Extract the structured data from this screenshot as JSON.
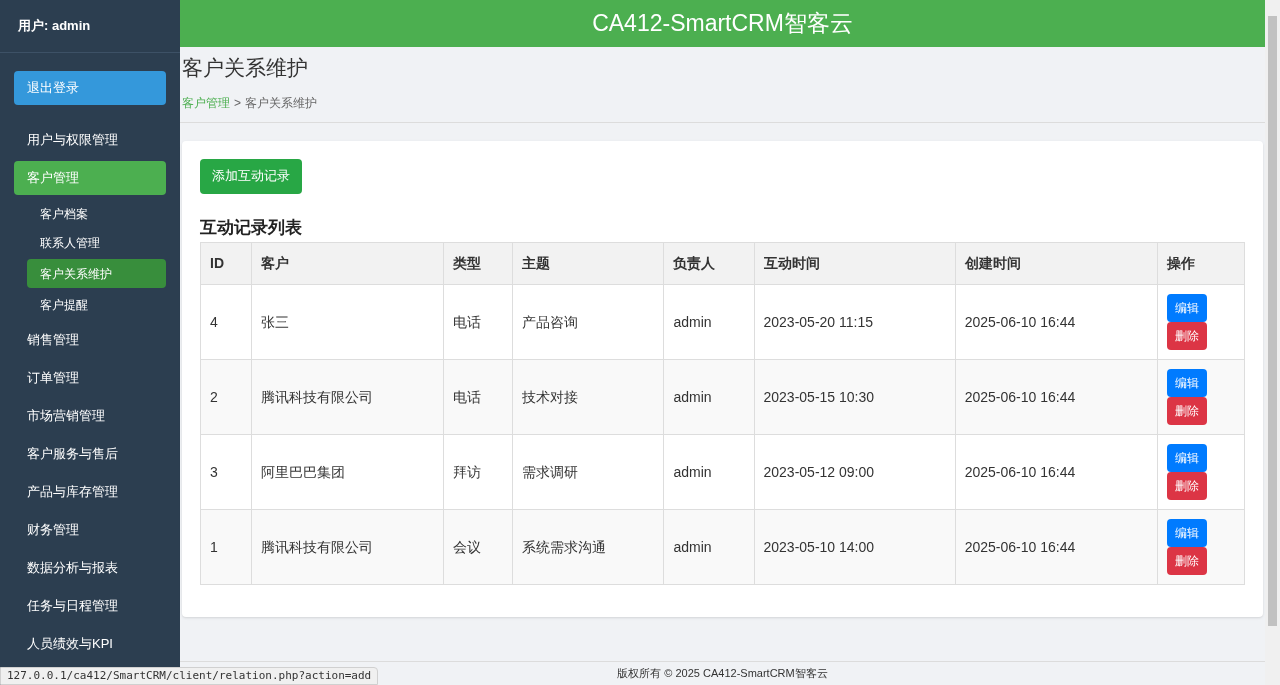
{
  "sidebar": {
    "user": "用户: admin",
    "logout": "退出登录",
    "items": [
      {
        "label": "用户与权限管理",
        "selected": false
      },
      {
        "label": "客户管理",
        "selected": true,
        "children": [
          {
            "label": "客户档案",
            "selected": false
          },
          {
            "label": "联系人管理",
            "selected": false
          },
          {
            "label": "客户关系维护",
            "selected": true
          },
          {
            "label": "客户提醒",
            "selected": false
          }
        ]
      },
      {
        "label": "销售管理",
        "selected": false
      },
      {
        "label": "订单管理",
        "selected": false
      },
      {
        "label": "市场营销管理",
        "selected": false
      },
      {
        "label": "客户服务与售后",
        "selected": false
      },
      {
        "label": "产品与库存管理",
        "selected": false
      },
      {
        "label": "财务管理",
        "selected": false
      },
      {
        "label": "数据分析与报表",
        "selected": false
      },
      {
        "label": "任务与日程管理",
        "selected": false
      },
      {
        "label": "人员绩效与KPI",
        "selected": false
      }
    ]
  },
  "header": {
    "title": "CA412-SmartCRM智客云"
  },
  "page": {
    "title": "客户关系维护",
    "breadcrumb": [
      {
        "label": "客户管理",
        "kind": "link"
      },
      {
        "label": ">",
        "kind": "separator"
      },
      {
        "label": "客户关系维护",
        "kind": "current"
      }
    ]
  },
  "add_button": "添加互动记录",
  "table": {
    "title": "互动记录列表",
    "columns": [
      "ID",
      "客户",
      "类型",
      "主题",
      "负责人",
      "互动时间",
      "创建时间",
      "操作"
    ],
    "rows": [
      {
        "cells": [
          "4",
          "张三",
          "电话",
          "产品咨询",
          "admin",
          "2023-05-20 11:15",
          "2025-06-10 16:44"
        ],
        "actions": [
          "编辑",
          "删除"
        ]
      },
      {
        "cells": [
          "2",
          "腾讯科技有限公司",
          "电话",
          "技术对接",
          "admin",
          "2023-05-15 10:30",
          "2025-06-10 16:44"
        ],
        "actions": [
          "编辑",
          "删除"
        ]
      },
      {
        "cells": [
          "3",
          "阿里巴巴集团",
          "拜访",
          "需求调研",
          "admin",
          "2023-05-12 09:00",
          "2025-06-10 16:44"
        ],
        "actions": [
          "编辑",
          "删除"
        ]
      },
      {
        "cells": [
          "1",
          "腾讯科技有限公司",
          "会议",
          "系统需求沟通",
          "admin",
          "2023-05-10 14:00",
          "2025-06-10 16:44"
        ],
        "actions": [
          "编辑",
          "删除"
        ]
      }
    ]
  },
  "footer": "版权所有 © 2025 CA412-SmartCRM智客云",
  "status_url": "127.0.0.1/ca412/SmartCRM/client/relation.php?action=add"
}
